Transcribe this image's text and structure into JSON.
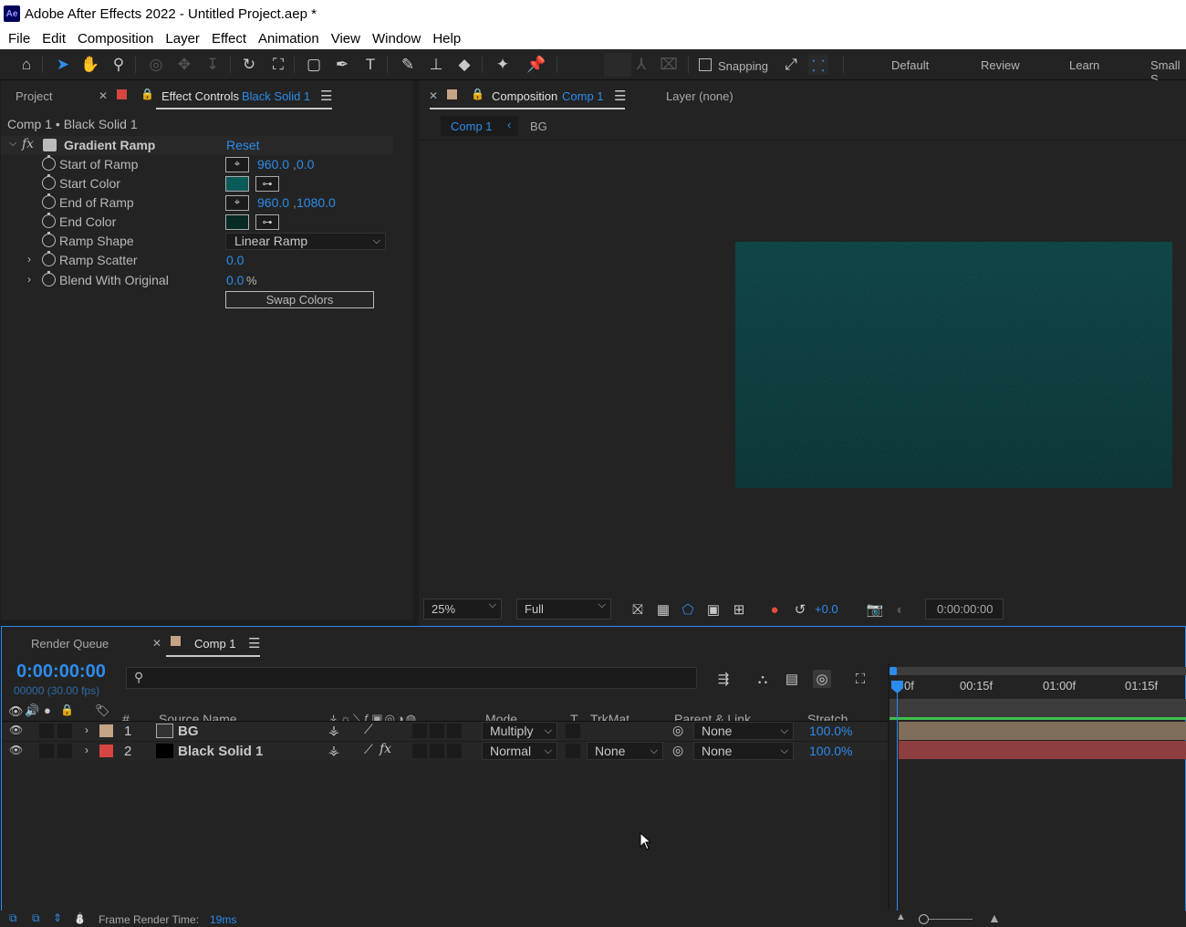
{
  "window": {
    "title": "Adobe After Effects 2022 - Untitled Project.aep *",
    "app_badge": "Ae"
  },
  "menu": [
    "File",
    "Edit",
    "Composition",
    "Layer",
    "Effect",
    "Animation",
    "View",
    "Window",
    "Help"
  ],
  "toolbar": {
    "snapping_label": "Snapping",
    "workspaces": [
      "Default",
      "Review",
      "Learn",
      "Small S"
    ]
  },
  "left_panel": {
    "tab_project": "Project",
    "tab_effect_controls": "Effect Controls",
    "tab_effect_controls_target": "Black Solid 1",
    "breadcrumb": "Comp 1 • Black Solid 1",
    "effect": {
      "name": "Gradient Ramp",
      "reset_label": "Reset",
      "start_of_ramp": {
        "label": "Start of Ramp",
        "x": "960.0",
        "y": "0.0"
      },
      "start_color": {
        "label": "Start Color",
        "color": "#0b5a5a"
      },
      "end_of_ramp": {
        "label": "End of Ramp",
        "x": "960.0",
        "y": "1080.0"
      },
      "end_color": {
        "label": "End Color",
        "color": "#082a24"
      },
      "ramp_shape": {
        "label": "Ramp Shape",
        "value": "Linear Ramp"
      },
      "ramp_scatter": {
        "label": "Ramp Scatter",
        "value": "0.0"
      },
      "blend_with_original": {
        "label": "Blend With Original",
        "value": "0.0",
        "unit": "%"
      },
      "swap_colors_label": "Swap Colors"
    }
  },
  "comp_panel": {
    "tab_label": "Composition",
    "tab_target": "Comp 1",
    "layer_tab": "Layer (none)",
    "breadcrumb_comp": "Comp 1",
    "breadcrumb_layer": "BG",
    "zoom": "25%",
    "resolution": "Full",
    "exposure": "+0.0",
    "timecode": "0:00:00:00"
  },
  "timeline": {
    "tab_render_queue": "Render Queue",
    "tab_comp": "Comp 1",
    "current_time": "0:00:00:00",
    "fps_info": "00000 (30.00 fps)",
    "search_placeholder": "",
    "columns": {
      "hash": "#",
      "source_name": "Source Name",
      "mode": "Mode",
      "t": "T",
      "trkmat": "TrkMat",
      "parent": "Parent & Link",
      "stretch": "Stretch"
    },
    "ruler": [
      "0f",
      "00:15f",
      "01:00f",
      "01:15f"
    ],
    "layers": [
      {
        "num": "1",
        "name": "BG",
        "label_color": "#c4a484",
        "mode": "Multiply",
        "trkmat": "",
        "parent": "None",
        "stretch": "100.0%",
        "bar_color": "#7f6e5b"
      },
      {
        "num": "2",
        "name": "Black Solid 1",
        "label_color": "#d64541",
        "mode": "Normal",
        "trkmat": "None",
        "parent": "None",
        "stretch": "100.0%",
        "bar_color": "#8d3f3f"
      }
    ]
  },
  "status": {
    "label": "Frame Render Time:",
    "value": "19ms"
  }
}
